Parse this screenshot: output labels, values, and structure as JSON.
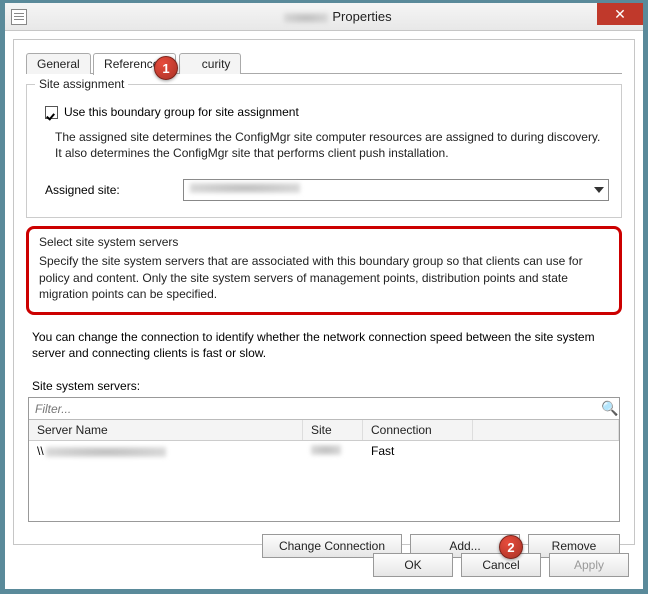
{
  "window": {
    "title_suffix": "Properties",
    "close_glyph": "✕"
  },
  "tabs": {
    "general": "General",
    "references": "References",
    "security": "curity"
  },
  "callouts": {
    "tab": "1",
    "add": "2"
  },
  "site_assignment": {
    "legend": "Site assignment",
    "checkbox_label": "Use this boundary group for site assignment",
    "description": "The assigned site determines the ConfigMgr site computer resources are assigned to during discovery. It also determines the ConfigMgr site that performs client push installation.",
    "assigned_site_label": "Assigned site:"
  },
  "select_servers": {
    "legend": "Select site system servers",
    "text": "Specify the site system servers that are associated with this boundary group so that clients can use for policy and content. Only the site system servers of management points, distribution points and state migration points can be specified."
  },
  "conn_note": "You can change the connection to identify whether the network connection speed between the site system server and connecting clients is fast or slow.",
  "servers": {
    "label": "Site system servers:",
    "filter_placeholder": "Filter...",
    "columns": {
      "name": "Server Name",
      "site": "Site",
      "conn": "Connection"
    },
    "rows": [
      {
        "name_prefix": "\\\\",
        "conn": "Fast"
      }
    ]
  },
  "buttons": {
    "change_conn": "Change Connection",
    "add": "Add...",
    "remove": "Remove",
    "ok": "OK",
    "cancel": "Cancel",
    "apply": "Apply"
  }
}
